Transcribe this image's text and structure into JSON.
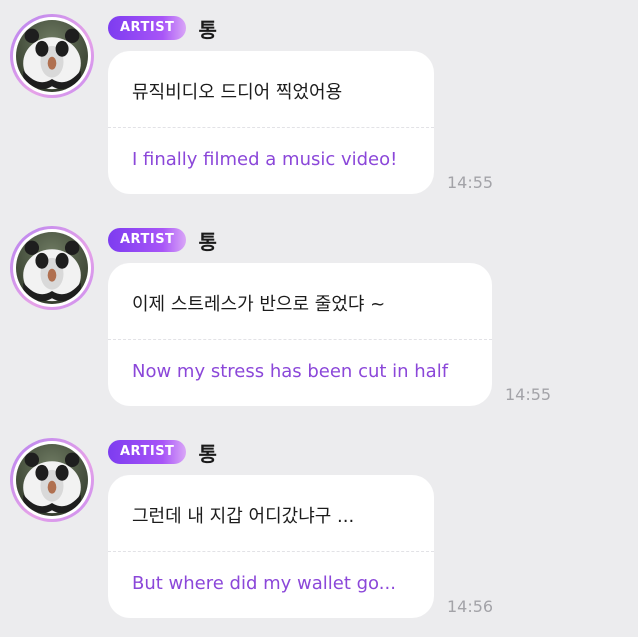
{
  "messages": [
    {
      "badge": "ARTIST",
      "sender": "통",
      "text_ko": "뮤직비디오 드디어 찍었어용",
      "text_en": "I finally filmed a music video!",
      "time": "14:55"
    },
    {
      "badge": "ARTIST",
      "sender": "통",
      "text_ko": "이제 스트레스가 반으로 줄었댜 ~",
      "text_en": "Now my stress has been cut in half",
      "time": "14:55"
    },
    {
      "badge": "ARTIST",
      "sender": "통",
      "text_ko": "그런데 내 지갑 어디갔냐구 ...",
      "text_en": "But where did my wallet go...",
      "time": "14:56"
    }
  ],
  "colors": {
    "background": "#ececee",
    "bubble": "#ffffff",
    "translation_text": "#8b47d9",
    "badge_gradient_start": "#7d3cf0",
    "badge_gradient_end": "#d9a6f7",
    "timestamp": "#a3a3a8"
  }
}
